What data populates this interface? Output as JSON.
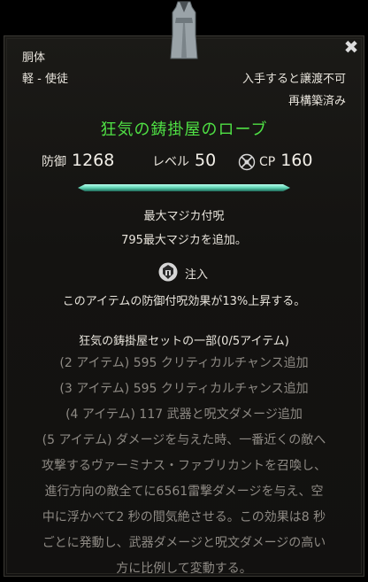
{
  "item": {
    "slot": "胴体",
    "weight": "軽 - 使徒",
    "bind": "入手すると譲渡不可",
    "reconstructed": "再構築済み",
    "name": "狂気の鋳掛屋のローブ",
    "armor_label": "防御",
    "armor_value": "1268",
    "level_label": "レベル",
    "level_value": "50",
    "cp_label": "CP",
    "cp_value": "160",
    "name_color": "#4fe044"
  },
  "enchant": {
    "title": "最大マジカ付呪",
    "desc_value": "795",
    "desc_text": "最大マジカを追加。"
  },
  "trait": {
    "name": "注入",
    "desc": "このアイテムの防御付呪効果が13%上昇する。"
  },
  "set": {
    "title": "狂気の鋳掛屋セットの一部(0/5アイテム)",
    "lines": [
      "(2 アイテム) 595 クリティカルチャンス追加",
      "(3 アイテム) 595 クリティカルチャンス追加",
      "(4 アイテム) 117 武器と呪文ダメージ追加",
      "(5 アイテム) ダメージを与えた時、一番近くの敵へ",
      "攻撃するヴァーミナス・ファブリカントを召喚し、",
      "進行方向の敵全てに6561雷撃ダメージを与え、空",
      "中に浮かべて2 秒の間気絶させる。この効果は8 秒",
      "ごとに発動し、武器ダメージと呪文ダメージの高い",
      "方に比例して変動する。"
    ]
  },
  "icons": {
    "item": "robe-icon",
    "close": "close-icon",
    "cp": "champion-point-icon",
    "trait": "infused-trait-icon"
  },
  "close_glyph": "✖"
}
